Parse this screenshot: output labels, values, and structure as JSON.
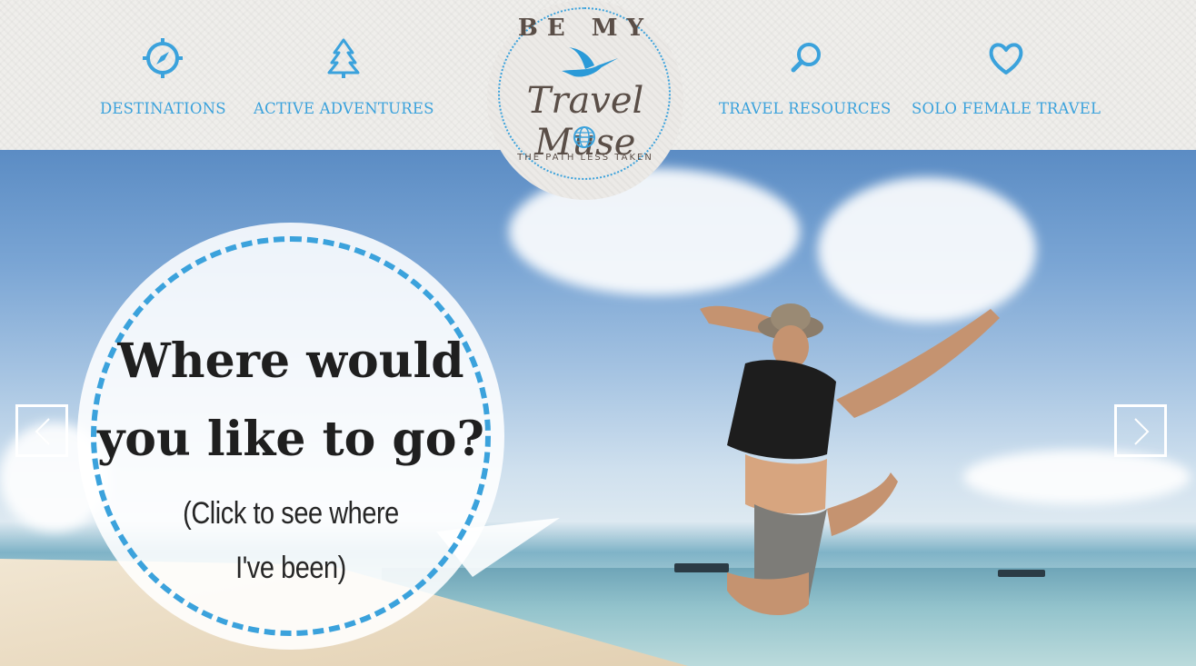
{
  "nav": {
    "left": [
      {
        "label": "DESTINATIONS",
        "icon": "compass-icon"
      },
      {
        "label": "ACTIVE ADVENTURES",
        "icon": "tree-icon"
      }
    ],
    "right": [
      {
        "label": "TRAVEL RESOURCES",
        "icon": "search-icon"
      },
      {
        "label": "SOLO FEMALE TRAVEL",
        "icon": "heart-icon"
      }
    ]
  },
  "logo": {
    "top": "BE MY",
    "script": "Travel Muse",
    "tagline": "THE PATH LESS TAKEN"
  },
  "hero": {
    "bubble_title_line1": "Where would",
    "bubble_title_line2": "you like to go?",
    "bubble_sub_line1": "(Click to see where",
    "bubble_sub_line2": "I've been)"
  },
  "colors": {
    "accent": "#3ba2dc",
    "logo_brown": "#5a4e47",
    "header_bg": "#efeeeb"
  }
}
